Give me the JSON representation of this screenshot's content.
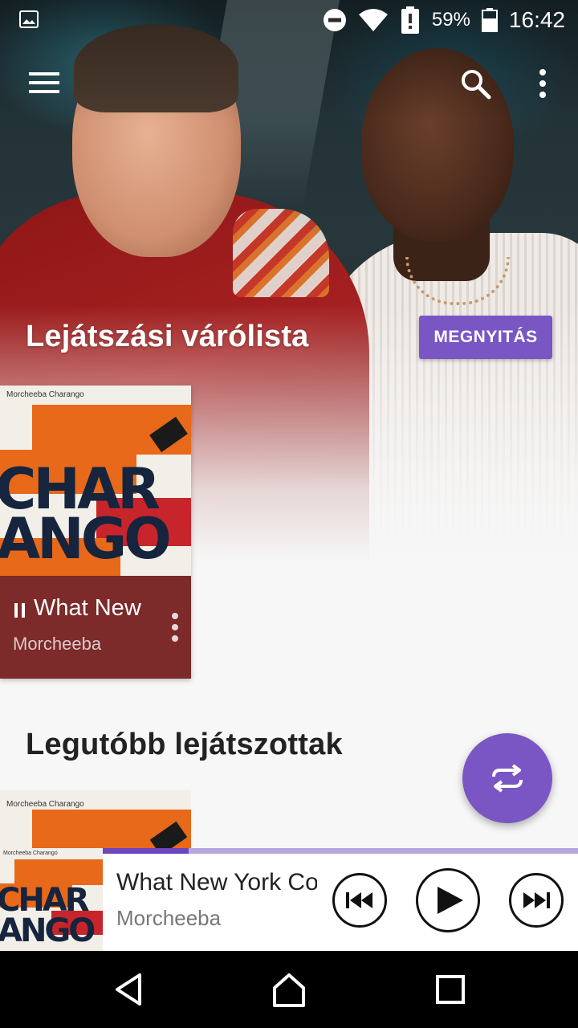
{
  "status_bar": {
    "battery_percent": "59%",
    "time": "16:42",
    "icons": [
      "image-notification-icon",
      "do-not-disturb-icon",
      "wifi-icon",
      "battery-alert-icon",
      "battery-icon"
    ]
  },
  "app_bar": {
    "icons": [
      "menu-icon",
      "search-icon",
      "more-vert-icon"
    ]
  },
  "queue": {
    "title": "Lejátszási várólista",
    "open_button": "MEGNYITÁS",
    "card": {
      "album_caption": "Morcheeba Charango",
      "album_letters_top": "CHAR",
      "album_letters_bottom": "ANGO",
      "title": "What New York Couples Fight About",
      "artist": "Morcheeba",
      "state_icon": "pause-icon"
    }
  },
  "recent": {
    "title": "Legutóbb lejátszottak",
    "card": {
      "album_caption": "Morcheeba Charango"
    }
  },
  "fab": {
    "icon": "repeat-icon"
  },
  "mini_player": {
    "album_caption": "Morcheeba Charango",
    "album_letters_top": "CHAR",
    "album_letters_bottom": "ANGO",
    "title": "What New York Couples Fight About",
    "artist": "Morcheeba",
    "progress": 0.18,
    "controls": [
      "skip-previous-icon",
      "play-icon",
      "skip-next-icon"
    ]
  },
  "nav_bar": {
    "icons": [
      "back-icon",
      "home-icon",
      "recents-icon"
    ]
  },
  "colors": {
    "accent": "#7a55c4",
    "card_info_bg": "#7c2a2a",
    "progress_fill": "#6c46bd",
    "progress_track": "#b7a7df"
  }
}
